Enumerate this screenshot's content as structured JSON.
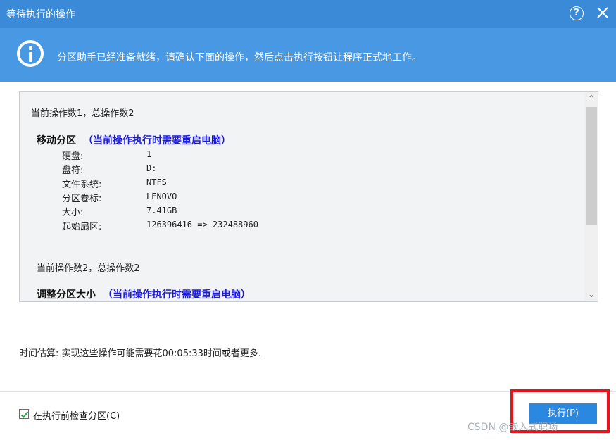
{
  "window": {
    "title": "等待执行的操作",
    "help_symbol": "?"
  },
  "banner": {
    "text": "分区助手已经准备就绪，请确认下面的操作，然后点击执行按钮让程序正式地工作。"
  },
  "operations": [
    {
      "count_text": "当前操作数1，总操作数2",
      "name": "移动分区",
      "note": "（当前操作执行时需要重启电脑）",
      "details": [
        {
          "label": "硬盘:",
          "value": "1"
        },
        {
          "label": "盘符:",
          "value": "D:"
        },
        {
          "label": "文件系统:",
          "value": "NTFS"
        },
        {
          "label": "分区卷标:",
          "value": "LENOVO"
        },
        {
          "label": "大小:",
          "value": "7.41GB"
        },
        {
          "label": "起始扇区:",
          "value": "126396416 => 232488960"
        }
      ]
    },
    {
      "count_text": "当前操作数2，总操作数2",
      "name": "调整分区大小",
      "note": "（当前操作执行时需要重启电脑）"
    }
  ],
  "scrollbar": {
    "up_symbol": "⌃",
    "down_symbol": "⌄"
  },
  "estimate": {
    "text": "时间估算: 实现这些操作可能需要花00:05:33时间或者更多."
  },
  "footer": {
    "checkbox_checked": true,
    "checkbox_label": "在执行前检查分区(C)",
    "execute_label": "执行(P)"
  },
  "watermark": "CSDN @嵌入式职场",
  "colors": {
    "titlebar": "#3a8ad8",
    "banner": "#4898e4",
    "execute_button": "#2a88e0",
    "highlight": "#e8141c",
    "note_text": "#1a1ad8"
  }
}
